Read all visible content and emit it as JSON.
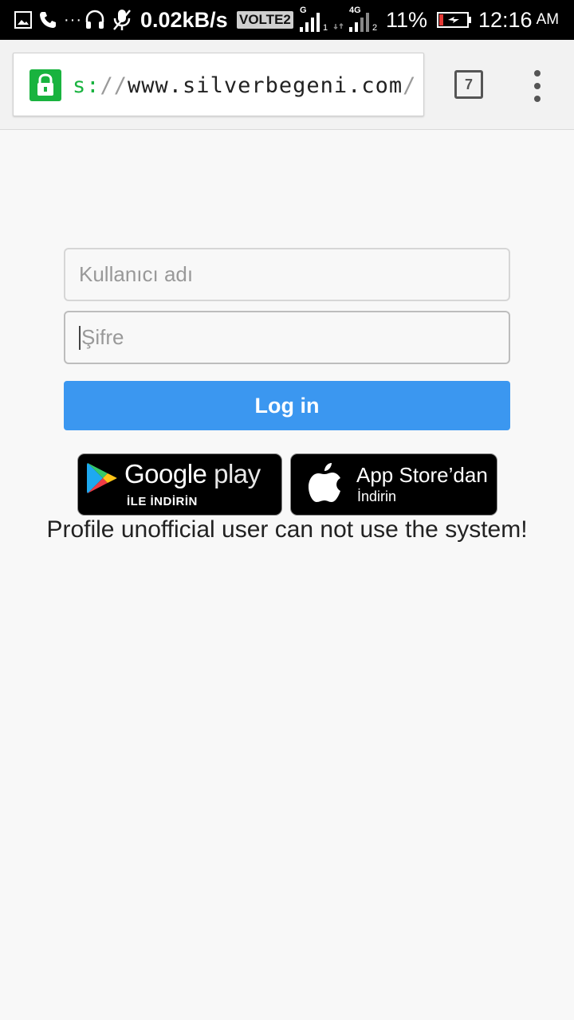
{
  "status_bar": {
    "data_rate": "0.02kB/s",
    "volte": "VOLTE2",
    "sim1_type": "G",
    "sim1_slot": "1",
    "sim2_type": "4G",
    "sim2_slot": "2",
    "battery": "11%",
    "time": "12:16",
    "ampm": "AM"
  },
  "browser": {
    "url_scheme": "s:",
    "url_sep": "//",
    "url_host": "www.silverbegeni.com",
    "url_tail": "/l",
    "tabs_count": "7"
  },
  "login": {
    "username_placeholder": "Kullanıcı adı",
    "password_placeholder": "Şifre",
    "login_label": "Log in"
  },
  "badges": {
    "google_play_title_strong": "Google",
    "google_play_title_light": " play",
    "google_play_sub": "İLE İNDİRİN",
    "app_store_title": "App Store’dan",
    "app_store_sub": "İndirin"
  },
  "notice": "Profile unofficial user can not use the system!",
  "colors": {
    "accent": "#3b97f0",
    "secure_green": "#19b33f"
  }
}
